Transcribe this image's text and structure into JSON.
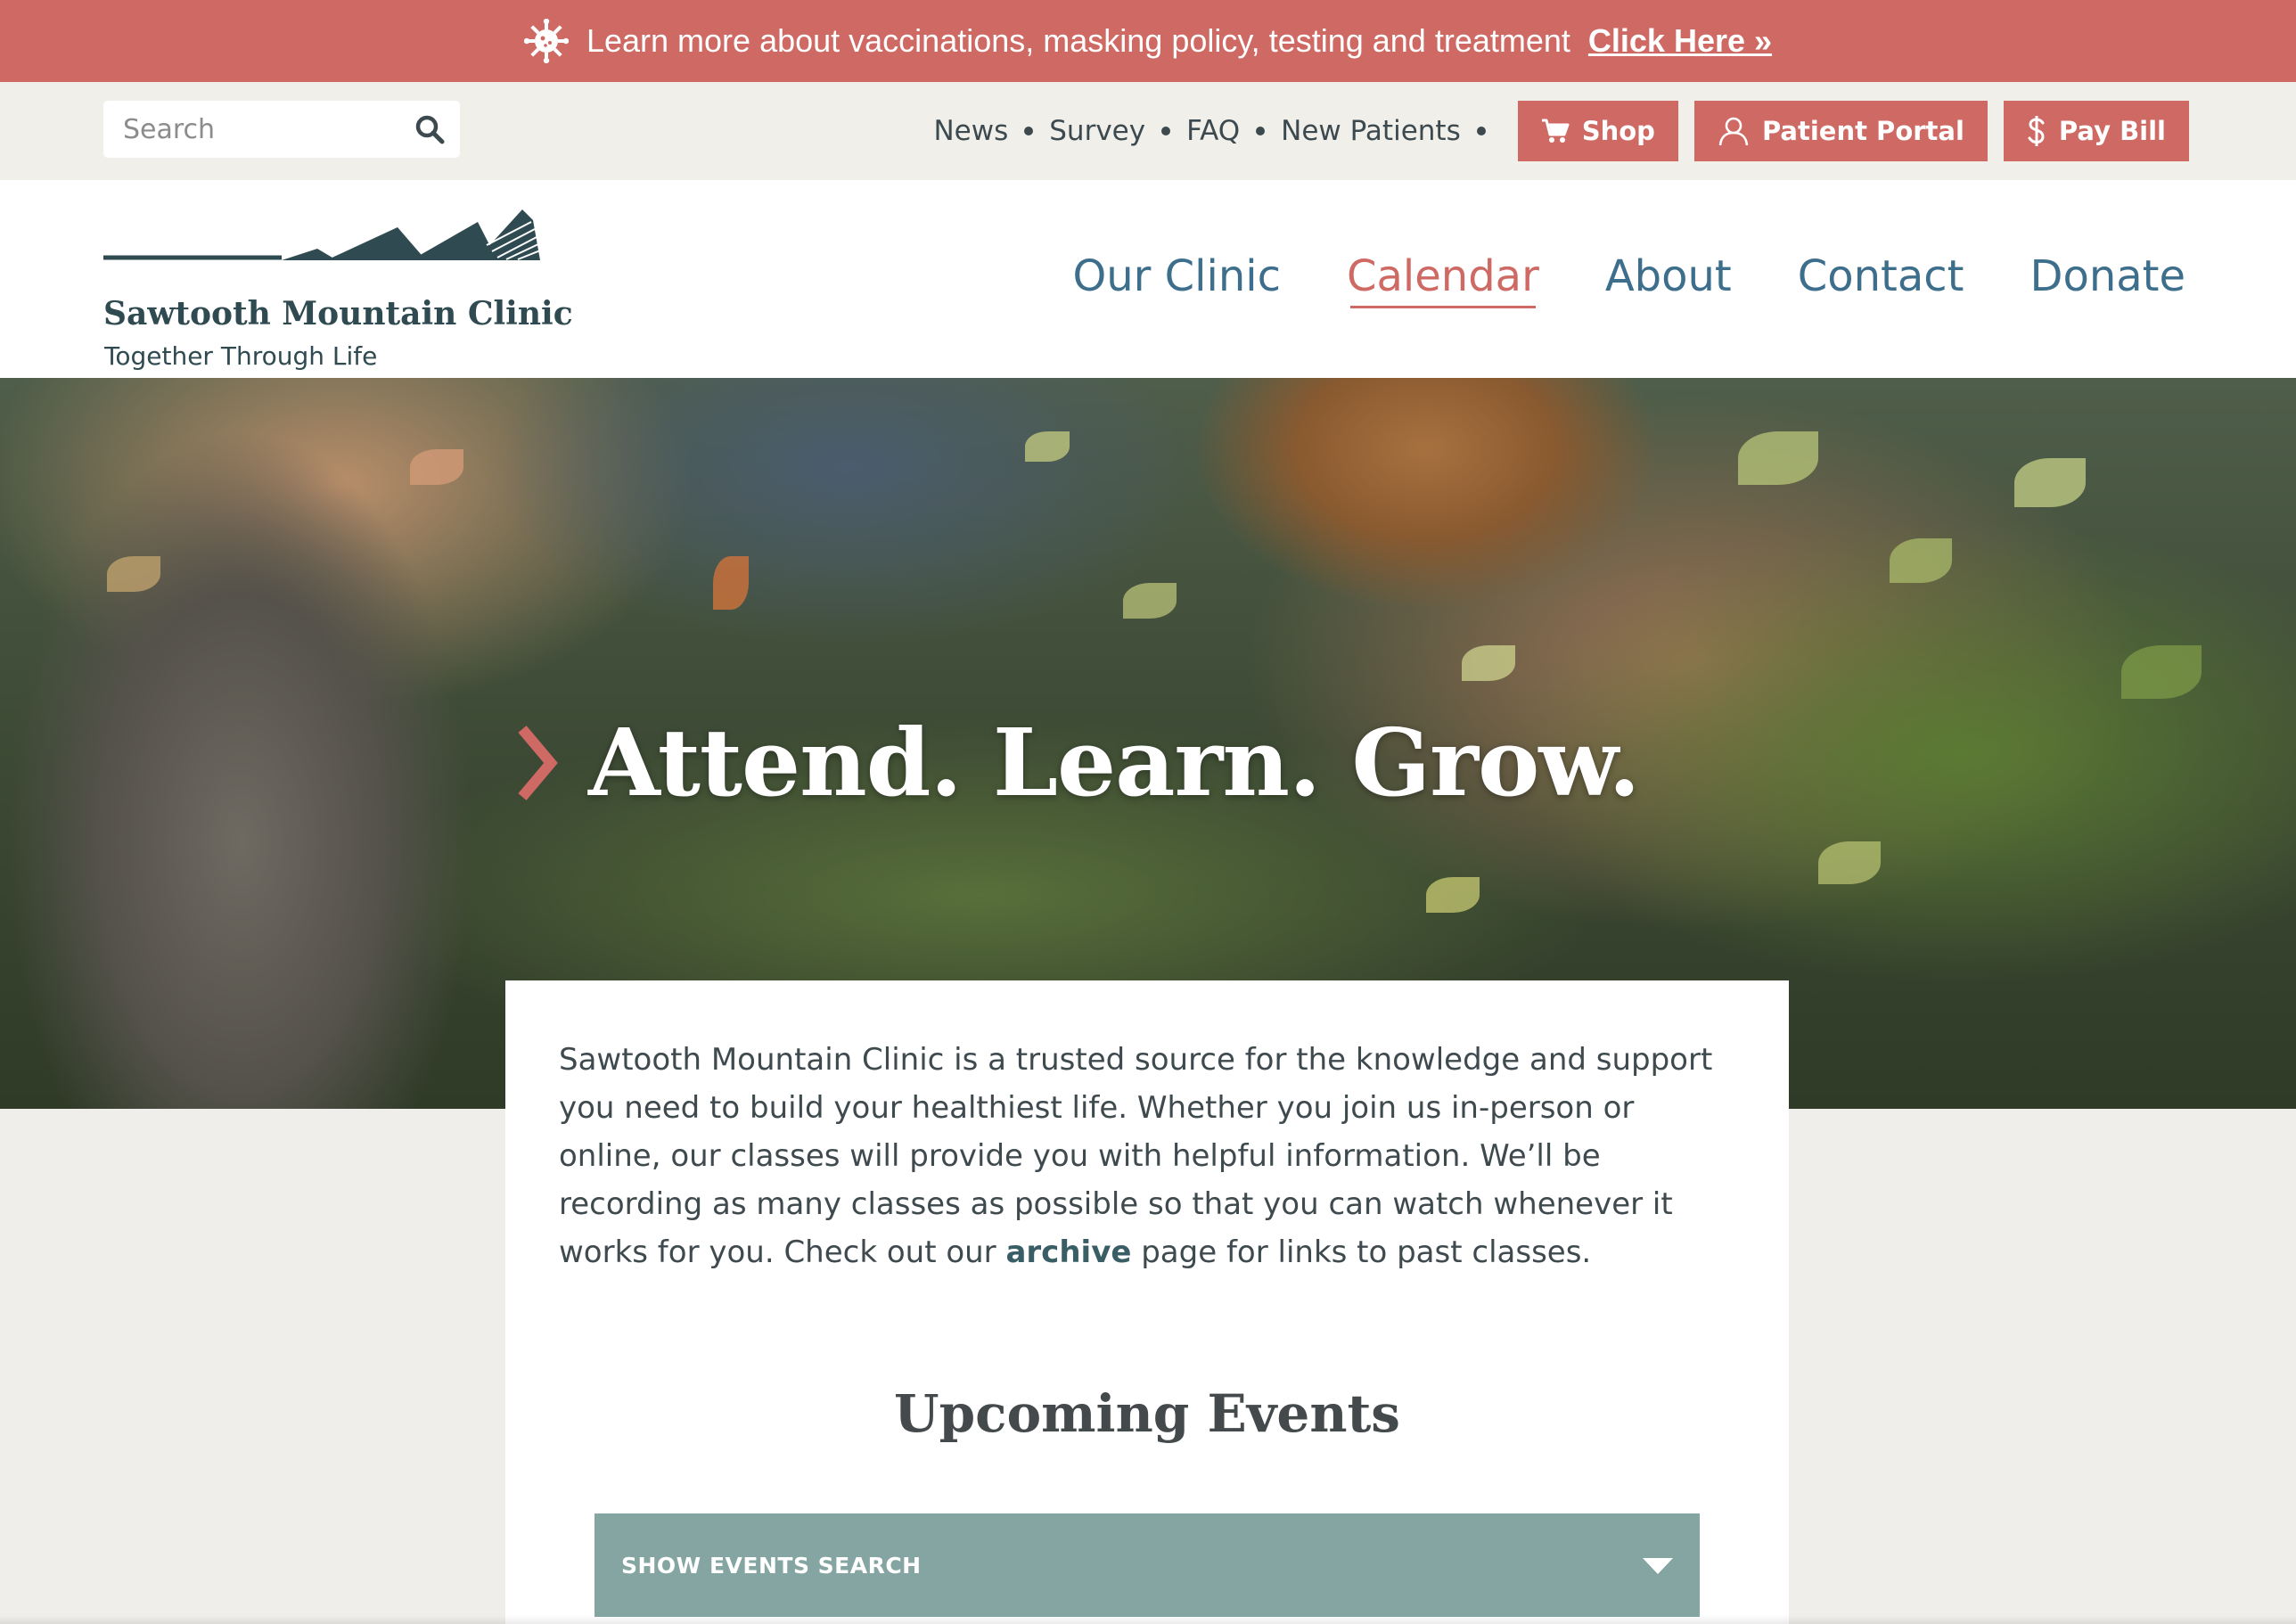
{
  "alert": {
    "text": "Learn more about vaccinations, masking policy, testing and treatment",
    "link_label": "Click Here »",
    "icon": "virus-icon",
    "color": "#cf6963"
  },
  "search": {
    "placeholder": "Search",
    "value": "",
    "icon": "search-icon"
  },
  "utility_nav": {
    "links": [
      "News",
      "Survey",
      "FAQ",
      "New Patients"
    ],
    "buttons": [
      {
        "label": "Shop",
        "icon": "cart-icon"
      },
      {
        "label": "Patient Portal",
        "icon": "user-icon"
      },
      {
        "label": "Pay Bill",
        "icon": "dollar-icon"
      }
    ]
  },
  "logo": {
    "name": "Sawtooth Mountain Clinic",
    "tagline": "Together Through Life",
    "color": "#2f4a50"
  },
  "main_nav": {
    "items": [
      "Our Clinic",
      "Calendar",
      "About",
      "Contact",
      "Donate"
    ],
    "active": "Calendar",
    "color": "#3d6f8c",
    "active_color": "#cf6963"
  },
  "hero": {
    "title": "Attend. Learn. Grow.",
    "chevron_color": "#cf6963"
  },
  "intro": {
    "text_before": "Sawtooth Mountain Clinic is a trusted source for the knowledge and support you need to build your healthiest life. Whether you join us in-person or online, our classes will provide you with helpful information. We’ll be recording as many classes as possible so that you can watch whenever it works for you. Check out our ",
    "link_label": "archive",
    "text_after": " page for links to past classes."
  },
  "events": {
    "heading": "Upcoming Events",
    "toggle_label": "SHOW EVENTS SEARCH",
    "toggle_color": "#85a5a3"
  }
}
